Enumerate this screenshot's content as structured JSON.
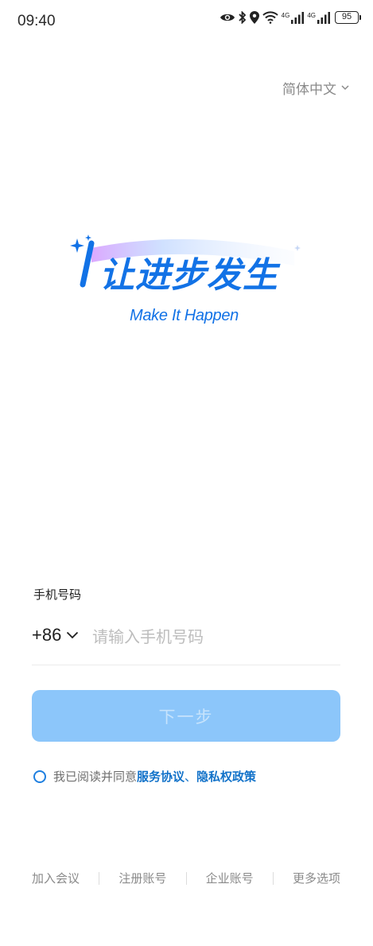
{
  "status_bar": {
    "time": "09:40",
    "icons": [
      "eye-icon",
      "bluetooth-icon",
      "location-icon",
      "wifi-icon",
      "signal-icon",
      "signal-icon"
    ],
    "network_label_1": "4G",
    "network_label_2": "4G",
    "battery": "95"
  },
  "language": {
    "label": "简体中文"
  },
  "logo": {
    "slogan_cn": "让进步发生",
    "slogan_en": "Make It Happen",
    "brand_color": "#1272e6"
  },
  "login": {
    "phone_label": "手机号码",
    "country_code": "+86",
    "phone_placeholder": "请输入手机号码",
    "next_label": "下一步",
    "button_color": "#8cc6fa"
  },
  "agreement": {
    "prefix": "我已阅读并同意",
    "service_link": "服务协议",
    "separator": "、",
    "privacy_link": "隐私权政策"
  },
  "bottom_options": {
    "join_meeting": "加入会议",
    "register": "注册账号",
    "enterprise": "企业账号",
    "more": "更多选项"
  }
}
